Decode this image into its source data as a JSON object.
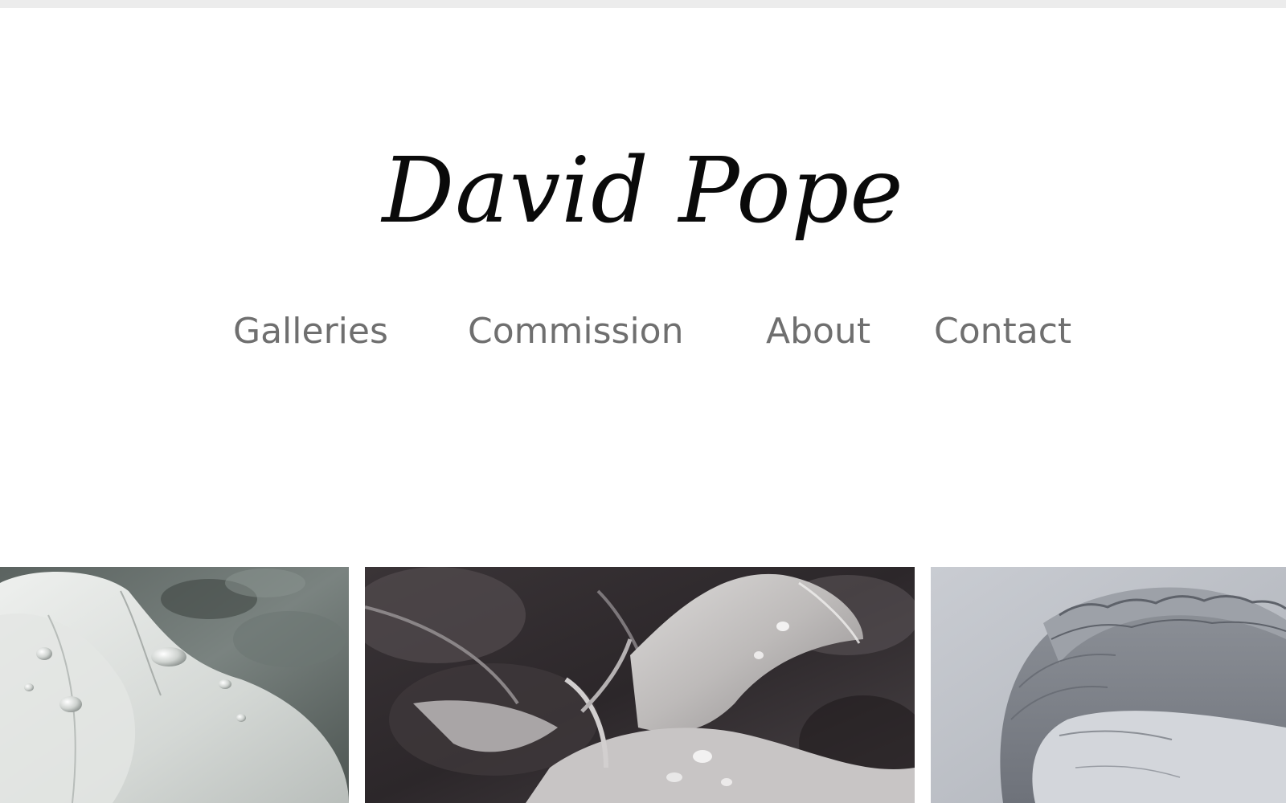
{
  "site": {
    "title": "David Pope"
  },
  "nav": {
    "items": [
      {
        "label": "Galleries"
      },
      {
        "label": "Commission"
      },
      {
        "label": "About"
      },
      {
        "label": "Contact"
      }
    ]
  },
  "gallery": {
    "tiles": [
      {
        "subject": "white petal with water droplets"
      },
      {
        "subject": "pale flower with droplets on dark leaves"
      },
      {
        "subject": "pencil portrait of braided hair"
      }
    ]
  },
  "colors": {
    "background": "#ffffff",
    "top_bar": "#ececec",
    "title": "#0a0a0a",
    "nav_text": "#6f6f6f"
  }
}
